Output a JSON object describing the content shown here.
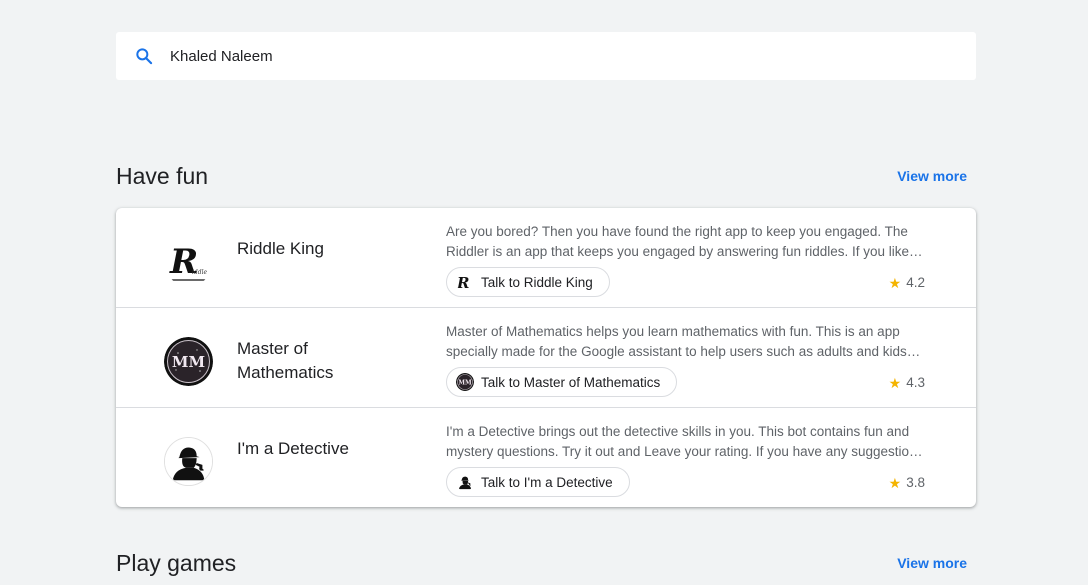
{
  "search": {
    "value": "Khaled Naleem"
  },
  "sections": [
    {
      "title": "Have fun",
      "view_more": "View more",
      "apps": [
        {
          "name": "Riddle King",
          "description": "Are you bored? Then you have found the right app to keep you engaged. The Riddler is an app that keeps you engaged by answering fun riddles. If you like riddles then this is the app for you.",
          "action": "Talk to Riddle King",
          "rating": "4.2",
          "icon": "riddle-king-logo"
        },
        {
          "name": "Master of Mathematics",
          "description": "Master of Mathematics helps you learn mathematics with fun. This is an app specially made for the Google assistant to help users such as adults and kids practice maths.",
          "action": "Talk to Master of Mathematics",
          "rating": "4.3",
          "icon": "master-of-mathematics-logo"
        },
        {
          "name": "I'm a Detective",
          "description": "I'm a Detective brings out the detective skills in you. This bot contains fun and mystery questions. Try it out and Leave your rating. If you have any suggestions let us know.",
          "action": "Talk to I'm a Detective",
          "rating": "3.8",
          "icon": "detective-logo"
        }
      ]
    },
    {
      "title": "Play games",
      "view_more": "View more"
    }
  ],
  "icons": {
    "search": "search-icon",
    "rating": "star-icon"
  },
  "colors": {
    "background": "#f1f3f4",
    "accent": "#1a73e8",
    "star": "#f4b400"
  }
}
